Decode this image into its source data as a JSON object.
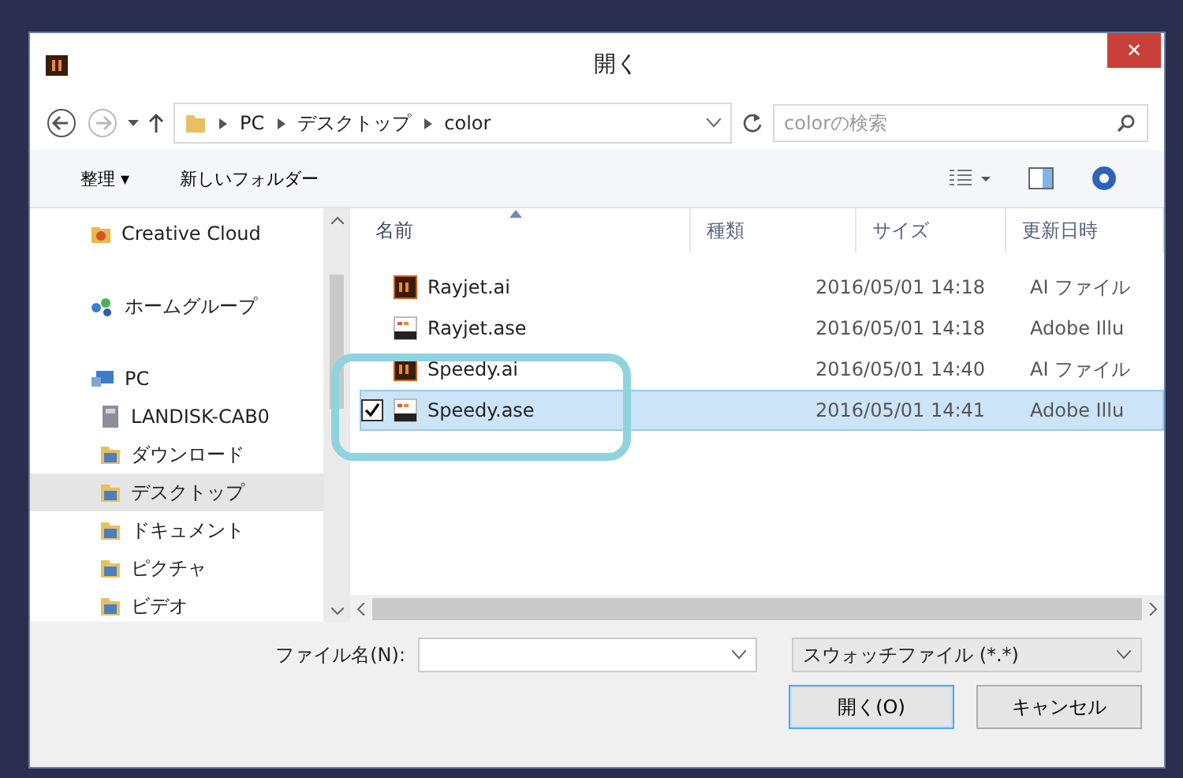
{
  "window": {
    "title": "開く",
    "close": "✕"
  },
  "address": {
    "path": [
      {
        "label": "PC"
      },
      {
        "label": "デスクトップ"
      },
      {
        "label": "color"
      }
    ]
  },
  "search": {
    "placeholder": "colorの検索"
  },
  "toolbar": {
    "organize": "整理 ▾",
    "new_folder": "新しいフォルダー"
  },
  "sidebar": {
    "items": [
      {
        "label": "Creative Cloud",
        "kind": "cloud",
        "selected": false
      },
      {
        "label": "ホームグループ",
        "kind": "homegroup",
        "selected": false
      },
      {
        "label": "PC",
        "kind": "pc",
        "selected": false
      },
      {
        "label": "LANDISK-CAB0",
        "kind": "drive",
        "selected": false
      },
      {
        "label": "ダウンロード",
        "kind": "folder",
        "selected": false
      },
      {
        "label": "デスクトップ",
        "kind": "folder",
        "selected": true
      },
      {
        "label": "ドキュメント",
        "kind": "folder",
        "selected": false
      },
      {
        "label": "ピクチャ",
        "kind": "folder",
        "selected": false
      },
      {
        "label": "ビデオ",
        "kind": "folder",
        "selected": false
      }
    ]
  },
  "table": {
    "columns": [
      {
        "label": "名前",
        "sorted": true
      },
      {
        "label": "種類",
        "sorted": false
      },
      {
        "label": "サイズ",
        "sorted": false
      },
      {
        "label": "更新日時",
        "sorted": false
      }
    ],
    "rows": [
      {
        "name": "Rayjet.ai",
        "date": "2016/05/01 14:18",
        "type": "AI ファイル",
        "kind": "ai",
        "selected": false,
        "checked": false
      },
      {
        "name": "Rayjet.ase",
        "date": "2016/05/01 14:18",
        "type": "Adobe Illu",
        "kind": "ase",
        "selected": false,
        "checked": false
      },
      {
        "name": "Speedy.ai",
        "date": "2016/05/01 14:40",
        "type": "AI ファイル",
        "kind": "ai",
        "selected": false,
        "checked": false
      },
      {
        "name": "Speedy.ase",
        "date": "2016/05/01 14:41",
        "type": "Adobe Illu",
        "kind": "ase",
        "selected": true,
        "checked": true
      }
    ]
  },
  "filename": {
    "label": "ファイル名(N):"
  },
  "filter": {
    "value": "スウォッチファイル (*.*)"
  },
  "buttons": [
    {
      "label": "開く(O)",
      "default": true
    },
    {
      "label": "キャンセル",
      "default": false
    }
  ]
}
